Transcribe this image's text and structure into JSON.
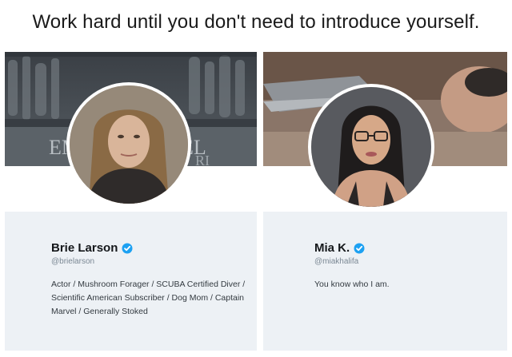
{
  "caption": "Work hard until you don't need to introduce yourself.",
  "profiles": [
    {
      "name": "Brie Larson",
      "handle": "@brielarson",
      "bio": "Actor / Mushroom Forager / SCUBA Certified Diver / Scientific American Subscriber / Dog Mom / Captain Marvel / Generally Stoked",
      "verified": true,
      "banner_text": "EM EL RI"
    },
    {
      "name": "Mia K.",
      "handle": "@miakhalifa",
      "bio": "You know who I am.",
      "verified": true
    }
  ],
  "colors": {
    "verified_badge": "#1da1f2",
    "panel_background": "#edf1f5"
  },
  "icons": [
    "verified-badge-icon"
  ]
}
